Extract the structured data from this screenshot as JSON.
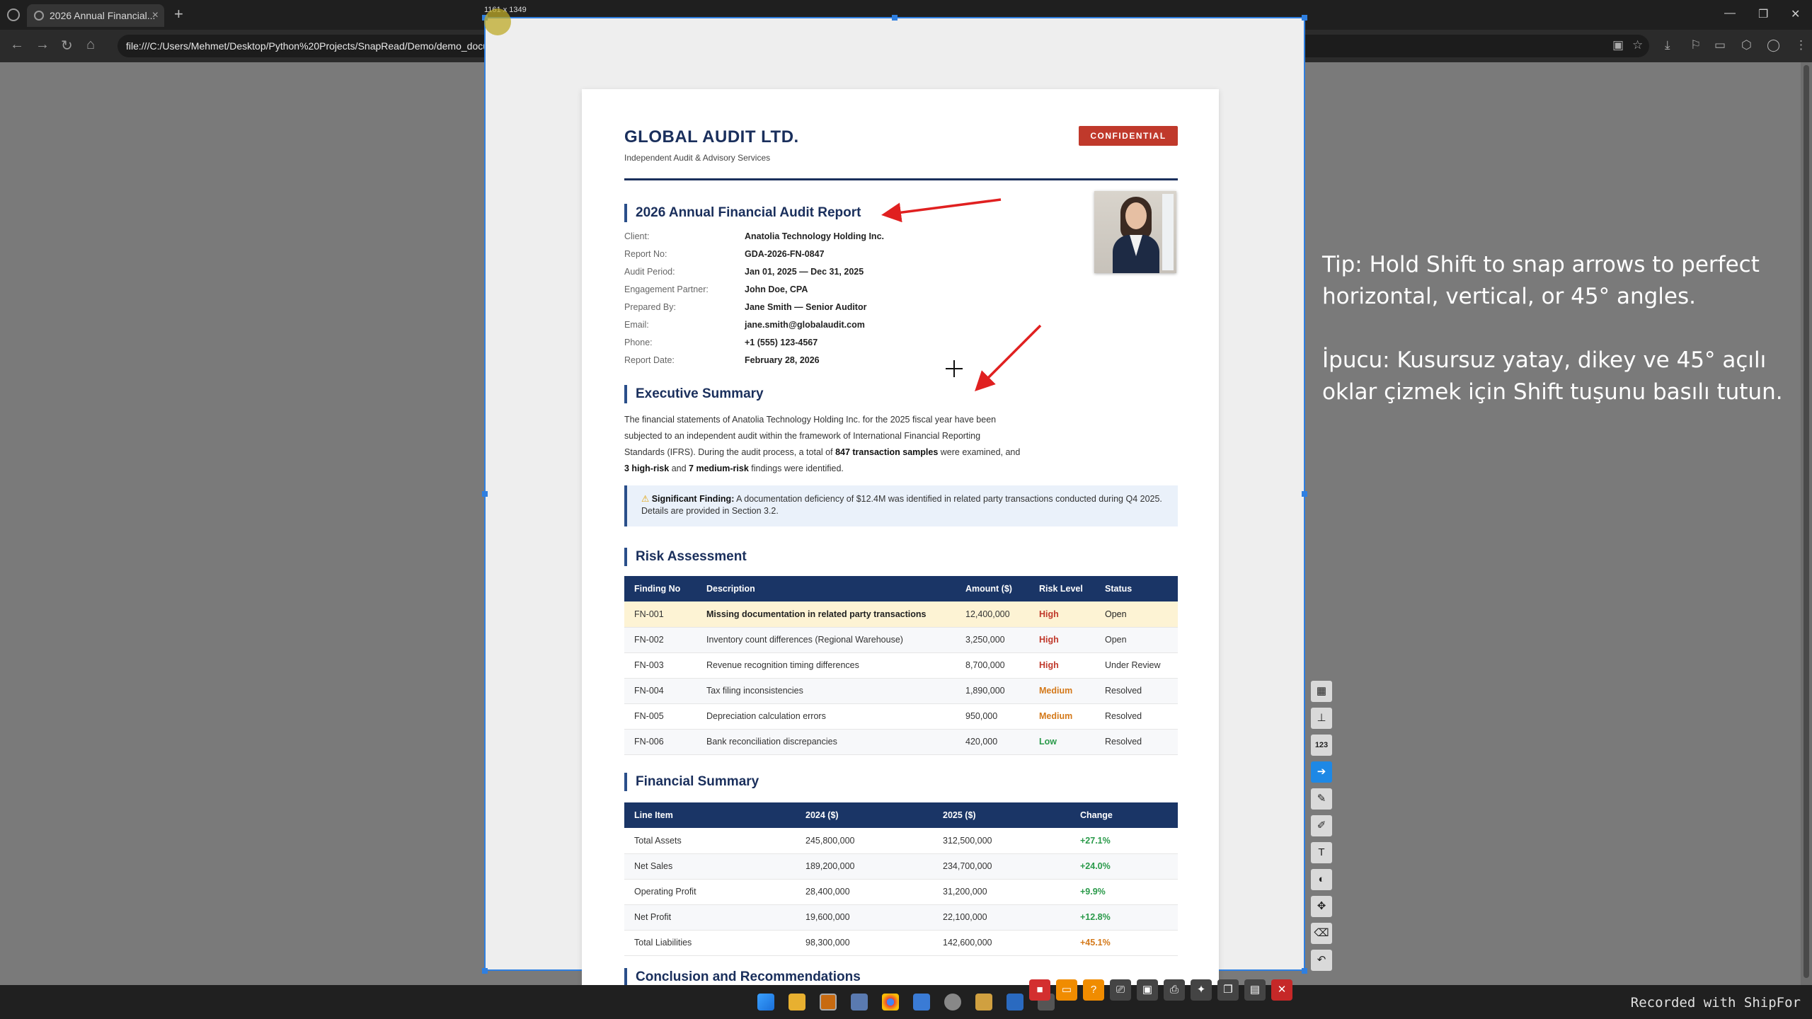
{
  "browser": {
    "tab_title": "2026 Annual Financial...",
    "url": "file:///C:/Users/Mehmet/Desktop/Python%20Projects/SnapRead/Demo/demo_document_en.html"
  },
  "capture": {
    "dimensions_label": "1161 x 1349"
  },
  "document": {
    "company": "GLOBAL AUDIT LTD.",
    "tagline": "Independent Audit & Advisory Services",
    "badge": "CONFIDENTIAL",
    "report_title": "2026 Annual Financial Audit Report",
    "info": [
      {
        "label": "Client:",
        "value": "Anatolia Technology Holding Inc."
      },
      {
        "label": "Report No:",
        "value": "GDA-2026-FN-0847"
      },
      {
        "label": "Audit Period:",
        "value": "Jan 01, 2025 — Dec 31, 2025"
      },
      {
        "label": "Engagement Partner:",
        "value": "John Doe, CPA"
      },
      {
        "label": "Prepared By:",
        "value": "Jane Smith — Senior Auditor"
      },
      {
        "label": "Email:",
        "value": "jane.smith@globalaudit.com"
      },
      {
        "label": "Phone:",
        "value": "+1 (555) 123-4567"
      },
      {
        "label": "Report Date:",
        "value": "February 28, 2026"
      }
    ],
    "exec_title": "Executive Summary",
    "exec_summary": {
      "p1": "The financial statements of Anatolia Technology Holding Inc. for the 2025 fiscal year have been subjected to an independent audit within the framework of International Financial Reporting Standards (IFRS). During the audit process, a total of ",
      "b1": "847 transaction samples",
      "p2": " were examined, and ",
      "b2": "3 high-risk",
      "p3": " and ",
      "b3": "7 medium-risk",
      "p4": " findings were identified."
    },
    "finding": {
      "icon": "warning-icon",
      "label": "Significant Finding:",
      "text": " A documentation deficiency of $12.4M was identified in related party transactions conducted during Q4 2025. Details are provided in Section 3.2."
    },
    "risk_title": "Risk Assessment",
    "risk_headers": [
      "Finding No",
      "Description",
      "Amount ($)",
      "Risk Level",
      "Status"
    ],
    "risk_rows": [
      [
        "FN-001",
        "Missing documentation in related party transactions",
        "12,400,000",
        "High",
        "Open"
      ],
      [
        "FN-002",
        "Inventory count differences (Regional Warehouse)",
        "3,250,000",
        "High",
        "Open"
      ],
      [
        "FN-003",
        "Revenue recognition timing differences",
        "8,700,000",
        "High",
        "Under Review"
      ],
      [
        "FN-004",
        "Tax filing inconsistencies",
        "1,890,000",
        "Medium",
        "Resolved"
      ],
      [
        "FN-005",
        "Depreciation calculation errors",
        "950,000",
        "Medium",
        "Resolved"
      ],
      [
        "FN-006",
        "Bank reconciliation discrepancies",
        "420,000",
        "Low",
        "Resolved"
      ]
    ],
    "fin_title": "Financial Summary",
    "fin_headers": [
      "Line Item",
      "2024 ($)",
      "2025 ($)",
      "Change"
    ],
    "fin_rows": [
      [
        "Total Assets",
        "245,800,000",
        "312,500,000",
        "+27.1%"
      ],
      [
        "Net Sales",
        "189,200,000",
        "234,700,000",
        "+24.0%"
      ],
      [
        "Operating Profit",
        "28,400,000",
        "31,200,000",
        "+9.9%"
      ],
      [
        "Net Profit",
        "19,600,000",
        "22,100,000",
        "+12.8%"
      ],
      [
        "Total Liabilities",
        "98,300,000",
        "142,600,000",
        "+45.1%"
      ]
    ],
    "next_title": "Conclusion and Recommendations"
  },
  "tip": {
    "en": "Tip: Hold Shift to snap arrows to perfect horizontal, vertical, or 45° angles.",
    "tr": "İpucu: Kusursuz yatay, dikey ve 45° açılı oklar çizmek için Shift tuşunu basılı tutun."
  },
  "side_tools": [
    "blur-icon",
    "stamp-icon",
    "counter-icon",
    "arrow-icon",
    "pen-icon",
    "marker-icon",
    "text-icon",
    "color-palette-icon",
    "move-icon",
    "eraser-icon",
    "undo-icon"
  ],
  "side_tool_glyphs": [
    "▦",
    "⊥",
    "123",
    "➔",
    "✎",
    "✐",
    "T",
    "◐",
    "✥",
    "⌫",
    "↶"
  ],
  "bottom_tools": [
    "record-icon",
    "screen-icon",
    "help-icon",
    "ocr-icon",
    "qr-icon",
    "print-icon",
    "pin-icon",
    "copy-icon",
    "save-icon",
    "close-icon"
  ],
  "bottom_tool_glyphs": [
    "■",
    "▭",
    "?",
    "⎚",
    "▣",
    "⎙",
    "✦",
    "❐",
    "▤",
    "✕"
  ],
  "colors": {
    "accent": "#1a2f5c",
    "danger": "#c0392b",
    "selection": "#2f7fe0",
    "annotation_arrow": "#e02020"
  },
  "recorded_label": "Recorded with ShipFor"
}
